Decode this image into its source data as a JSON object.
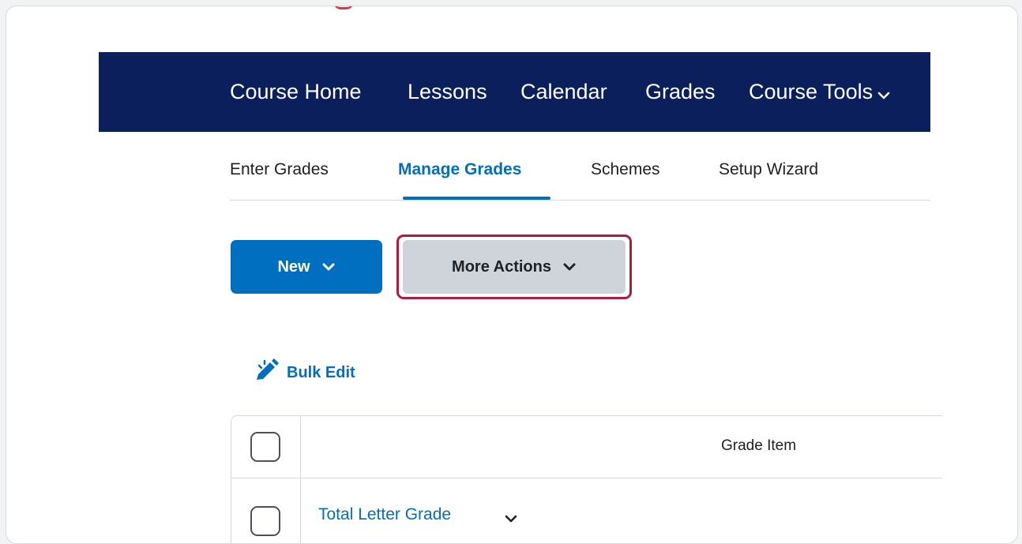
{
  "nav": {
    "items": [
      {
        "label": "Course Home"
      },
      {
        "label": "Lessons"
      },
      {
        "label": "Calendar"
      },
      {
        "label": "Grades"
      },
      {
        "label": "Course Tools"
      }
    ],
    "background": "#0a1f5c"
  },
  "subtabs": {
    "items": [
      {
        "label": "Enter Grades",
        "active": false
      },
      {
        "label": "Manage Grades",
        "active": true
      },
      {
        "label": "Schemes",
        "active": false
      },
      {
        "label": "Setup Wizard",
        "active": false
      }
    ],
    "accent": "#006fbf"
  },
  "actions": {
    "new_label": "New",
    "more_label": "More Actions",
    "highlight_color": "#b01c3c"
  },
  "bulk_edit": {
    "label": "Bulk Edit",
    "icon": "pencil-icon"
  },
  "grid": {
    "column_header": "Grade Item",
    "rows": [
      {
        "label": "Total Letter Grade"
      }
    ]
  }
}
